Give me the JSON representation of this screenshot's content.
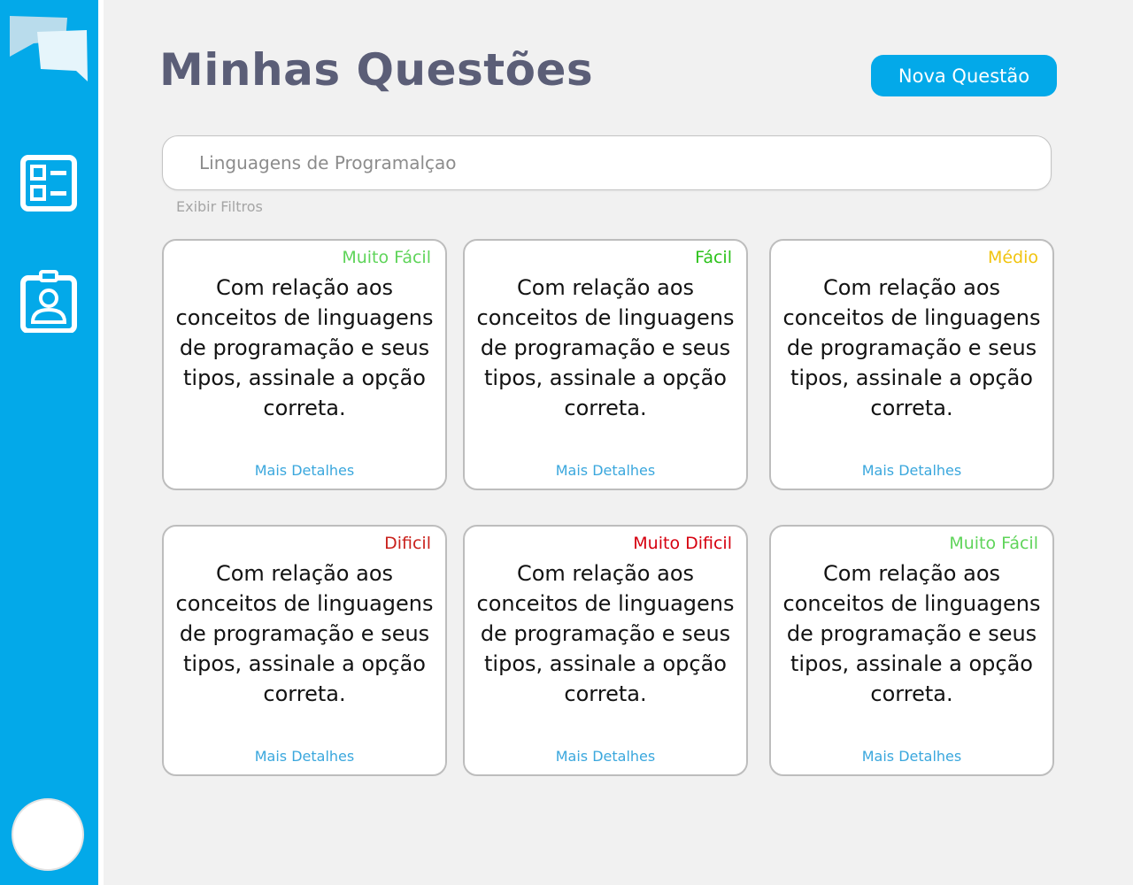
{
  "sidebar": {
    "logo_icon": "chat-bubbles-icon",
    "nav": [
      {
        "icon": "question-list-icon"
      },
      {
        "icon": "id-badge-icon"
      }
    ],
    "avatar_icon": "user-avatar-icon"
  },
  "header": {
    "title": "Minhas Questões",
    "new_button": "Nova Questão"
  },
  "search": {
    "value": "Linguagens de Programalçao"
  },
  "filters_label": "Exibir Filtros",
  "colors": {
    "accent": "#03a9e9",
    "muito_facil": "#5fd45a",
    "facil": "#2cc21b",
    "medio": "#f1c40f",
    "dificil": "#c9211c",
    "muito_dificil": "#d6000f",
    "link": "#3aa7dd"
  },
  "cards": [
    {
      "difficulty": "Muito Fácil",
      "color": "#5fd45a",
      "text": "Com relação aos conceitos de linguagens de programação e seus tipos, assinale a opção correta.",
      "link": "Mais Detalhes"
    },
    {
      "difficulty": "Fácil",
      "color": "#2cc21b",
      "text": "Com relação aos conceitos de linguagens de programação e seus tipos, assinale a opção correta.",
      "link": "Mais Detalhes"
    },
    {
      "difficulty": "Médio",
      "color": "#f1c40f",
      "text": "Com relação aos conceitos de linguagens de programação e seus tipos, assinale a opção correta.",
      "link": "Mais Detalhes"
    },
    {
      "difficulty": "Dificil",
      "color": "#c9211c",
      "text": "Com relação aos conceitos de linguagens de programação e seus tipos, assinale a opção correta.",
      "link": "Mais Detalhes"
    },
    {
      "difficulty": "Muito Dificil",
      "color": "#d6000f",
      "text": "Com relação aos conceitos de linguagens de programação e seus tipos, assinale a opção correta.",
      "link": "Mais Detalhes"
    },
    {
      "difficulty": "Muito Fácil",
      "color": "#5fd45a",
      "text": "Com relação aos conceitos de linguagens de programação e seus tipos, assinale a opção correta.",
      "link": "Mais Detalhes"
    }
  ]
}
